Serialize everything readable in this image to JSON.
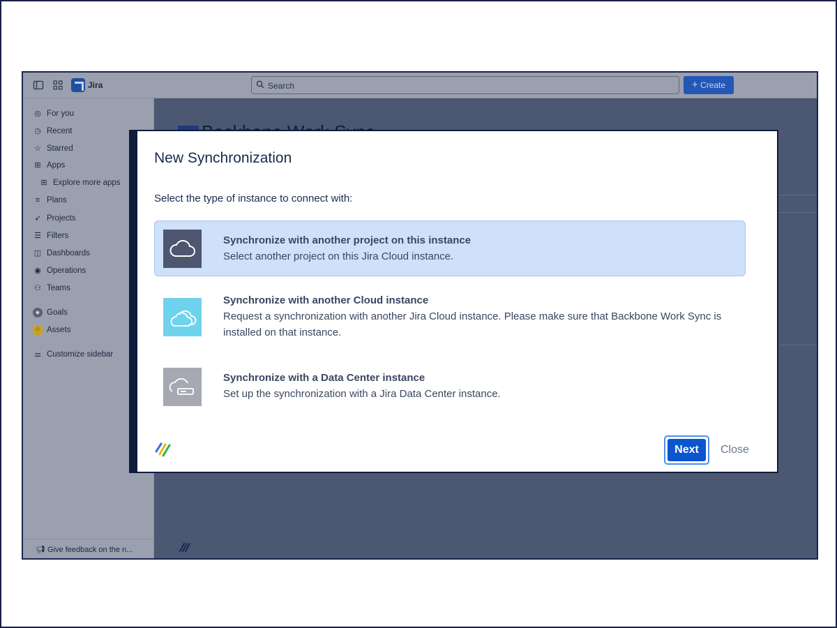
{
  "topbar": {
    "app_name": "Jira",
    "search_placeholder": "Search",
    "create_label": "Create"
  },
  "sidebar": {
    "items": [
      {
        "label": "For you",
        "icon": "user-circle-icon"
      },
      {
        "label": "Recent",
        "icon": "clock-icon"
      },
      {
        "label": "Starred",
        "icon": "star-icon"
      },
      {
        "label": "Apps",
        "icon": "apps-grid-icon"
      },
      {
        "label": "Explore more apps",
        "icon": "apps-plus-icon"
      },
      {
        "label": "Plans",
        "icon": "plans-icon"
      },
      {
        "label": "Projects",
        "icon": "rocket-icon"
      },
      {
        "label": "Filters",
        "icon": "filter-icon"
      },
      {
        "label": "Dashboards",
        "icon": "dashboard-icon"
      },
      {
        "label": "Operations",
        "icon": "operations-icon"
      },
      {
        "label": "Teams",
        "icon": "teams-icon"
      },
      {
        "label": "Goals",
        "icon": "goals-icon"
      },
      {
        "label": "Assets",
        "icon": "assets-icon"
      },
      {
        "label": "Customize sidebar",
        "icon": "sliders-icon"
      }
    ],
    "feedback": "Give feedback on the n..."
  },
  "main": {
    "title": "Backbone Work Sync"
  },
  "modal": {
    "title": "New Synchronization",
    "subtitle": "Select the type of instance to connect with:",
    "options": [
      {
        "title": "Synchronize with another project on this instance",
        "description": "Select another project on this Jira Cloud instance.",
        "icon": "cloud-icon",
        "color": "#4f5670",
        "selected": true
      },
      {
        "title": "Synchronize with another Cloud instance",
        "description": "Request a synchronization with another Jira Cloud instance. Please make sure that Backbone Work Sync is installed on that instance.",
        "icon": "double-cloud-icon",
        "color": "#6fd3ee",
        "selected": false
      },
      {
        "title": "Synchronize with a Data Center instance",
        "description": "Set up the synchronization with a Jira Data Center instance.",
        "icon": "cloud-server-icon",
        "color": "#a6a9b2",
        "selected": false
      }
    ],
    "next_label": "Next",
    "close_label": "Close"
  },
  "colors": {
    "primary": "#0b55cf",
    "selected_bg": "#cfe0fb",
    "overlay": "#4c5772"
  }
}
